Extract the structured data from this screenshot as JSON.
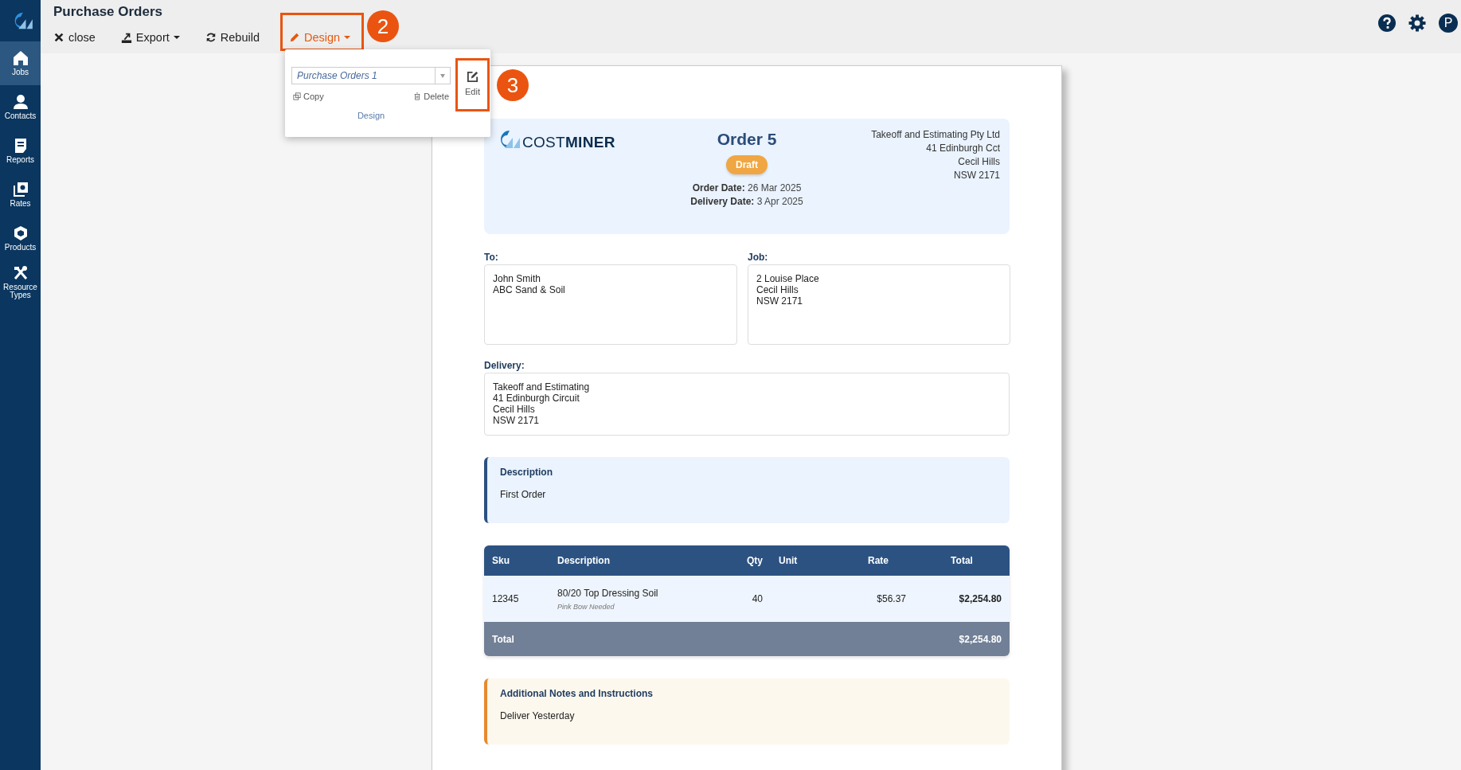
{
  "sidebar": {
    "items": [
      {
        "label": "Jobs",
        "selected": true
      },
      {
        "label": "Contacts",
        "selected": false
      },
      {
        "label": "Reports",
        "selected": false
      },
      {
        "label": "Rates",
        "selected": false
      },
      {
        "label": "Products",
        "selected": false
      },
      {
        "label": "Resource Types",
        "selected": false
      }
    ]
  },
  "topbar": {
    "title": "Purchase Orders",
    "buttons": [
      {
        "label": "close",
        "menu": false,
        "expanded": false
      },
      {
        "label": "Export",
        "menu": true,
        "expanded": false
      },
      {
        "label": "Rebuild",
        "menu": false,
        "expanded": false
      },
      {
        "label": "Design",
        "menu": true,
        "expanded": true
      }
    ],
    "avatar": "P"
  },
  "design_menu": {
    "template": "Purchase Orders 1",
    "actions": [
      "Copy",
      "Delete"
    ],
    "edit": "Edit",
    "caption": "Design"
  },
  "callouts": [
    {
      "number": "2"
    },
    {
      "number": "3"
    }
  ],
  "document": {
    "logo": "COST**MINER**",
    "title": "Order 5",
    "status": "Draft",
    "dates": [
      "**Order Date:** 26 Mar 2025",
      "**Delivery Date:** 3 Apr 2025"
    ],
    "company": [
      "Takeoff and Estimating Pty Ltd",
      "41 Edinburgh Cct",
      "Cecil Hills",
      "NSW 2171"
    ],
    "to": {
      "label": "To:",
      "lines": [
        "John Smith",
        "ABC Sand & Soil"
      ]
    },
    "job": {
      "label": "Job:",
      "lines": [
        "2 Louise Place",
        "Cecil Hills",
        "NSW 2171"
      ]
    },
    "delivery": {
      "label": "Delivery:",
      "lines": [
        "Takeoff and Estimating",
        "41 Edinburgh Circuit",
        "Cecil Hills",
        "NSW 2171"
      ]
    },
    "description": {
      "title": "Description",
      "text": "First Order"
    },
    "table": {
      "columns": [
        "Sku",
        "Description",
        "Qty",
        "Unit",
        "Rate",
        "Total"
      ],
      "rows": [
        {
          "sku": "12345",
          "description": "80/20 Top Dressing Soil",
          "note": "Pink Bow Needed",
          "qty": "40",
          "rate": "$56.37",
          "total": "$2,254.80"
        }
      ],
      "total_label": "Total",
      "total_value": "$2,254.80"
    },
    "notes": {
      "title": "Additional Notes and Instructions",
      "text": "Deliver Yesterday"
    }
  }
}
